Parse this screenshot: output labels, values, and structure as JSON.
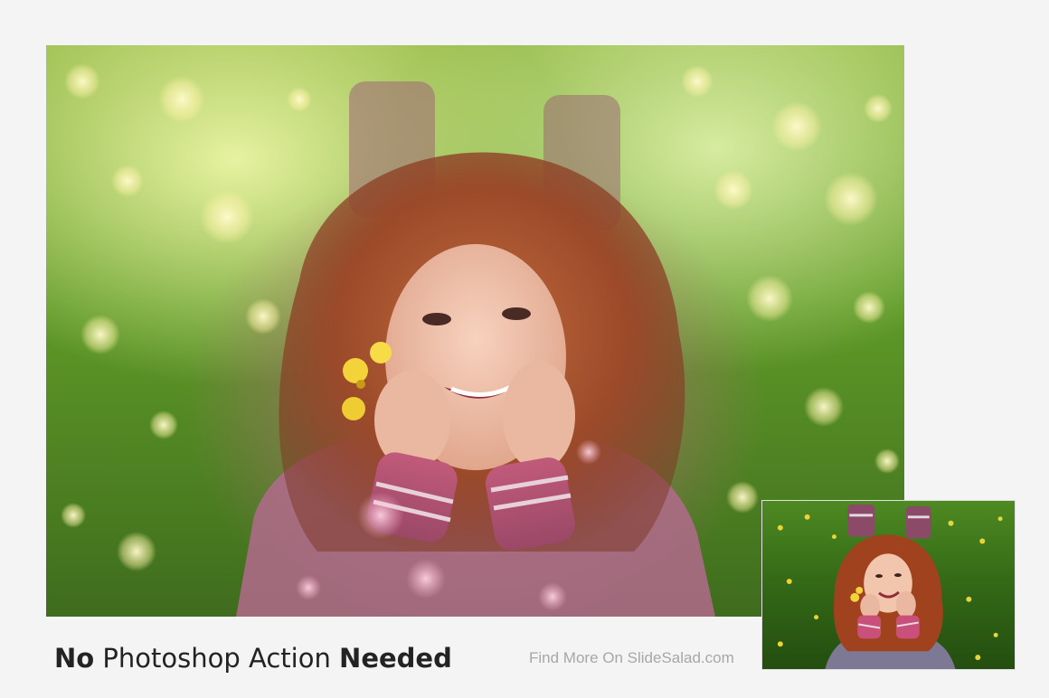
{
  "caption": {
    "part1": "No",
    "part2": "Photoshop Action",
    "part3": "Needed"
  },
  "credit": "Find More On SlideSalad.com",
  "colors": {
    "background": "#f4f4f4",
    "caption_text": "#232323",
    "credit_text": "#a7a7a7",
    "effect_grass": "#6ea232",
    "effect_glow": "#d6879b",
    "original_grass": "#3f7a1c"
  },
  "images": {
    "main": "girl-lying-in-grass-with-flowers-bokeh-light-effect",
    "thumbnail": "girl-lying-in-grass-original-photo"
  }
}
